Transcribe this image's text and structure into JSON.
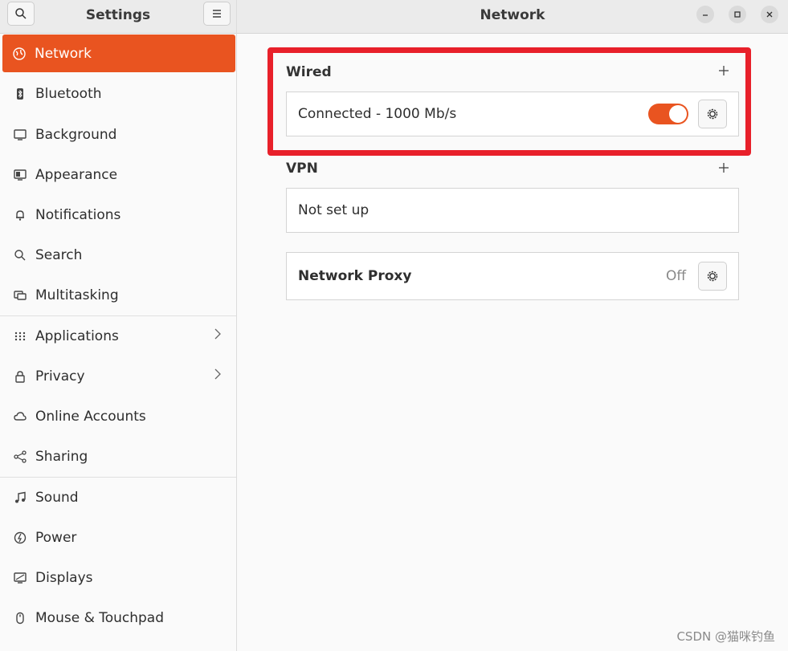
{
  "sidebar": {
    "title": "Settings",
    "items": [
      {
        "label": "Network",
        "icon": "globe-icon",
        "active": true
      },
      {
        "label": "Bluetooth",
        "icon": "bluetooth-icon"
      },
      {
        "label": "Background",
        "icon": "monitor-icon"
      },
      {
        "label": "Appearance",
        "icon": "appearance-icon"
      },
      {
        "label": "Notifications",
        "icon": "bell-icon"
      },
      {
        "label": "Search",
        "icon": "search-icon"
      },
      {
        "label": "Multitasking",
        "icon": "multitasking-icon"
      },
      {
        "label": "Applications",
        "icon": "grid-icon",
        "submenu": true
      },
      {
        "label": "Privacy",
        "icon": "lock-icon",
        "submenu": true
      },
      {
        "label": "Online Accounts",
        "icon": "cloud-icon"
      },
      {
        "label": "Sharing",
        "icon": "share-icon"
      },
      {
        "label": "Sound",
        "icon": "music-note-icon"
      },
      {
        "label": "Power",
        "icon": "power-icon"
      },
      {
        "label": "Displays",
        "icon": "display-icon"
      },
      {
        "label": "Mouse & Touchpad",
        "icon": "mouse-icon"
      }
    ]
  },
  "main": {
    "title": "Network",
    "wired": {
      "label": "Wired",
      "status": "Connected - 1000 Mb/s",
      "enabled": true
    },
    "vpn": {
      "label": "VPN",
      "status": "Not set up"
    },
    "proxy": {
      "label": "Network Proxy",
      "value": "Off"
    }
  },
  "watermark": "CSDN @猫咪钓鱼",
  "colors": {
    "accent": "#e95420",
    "highlight": "#e8202a"
  }
}
